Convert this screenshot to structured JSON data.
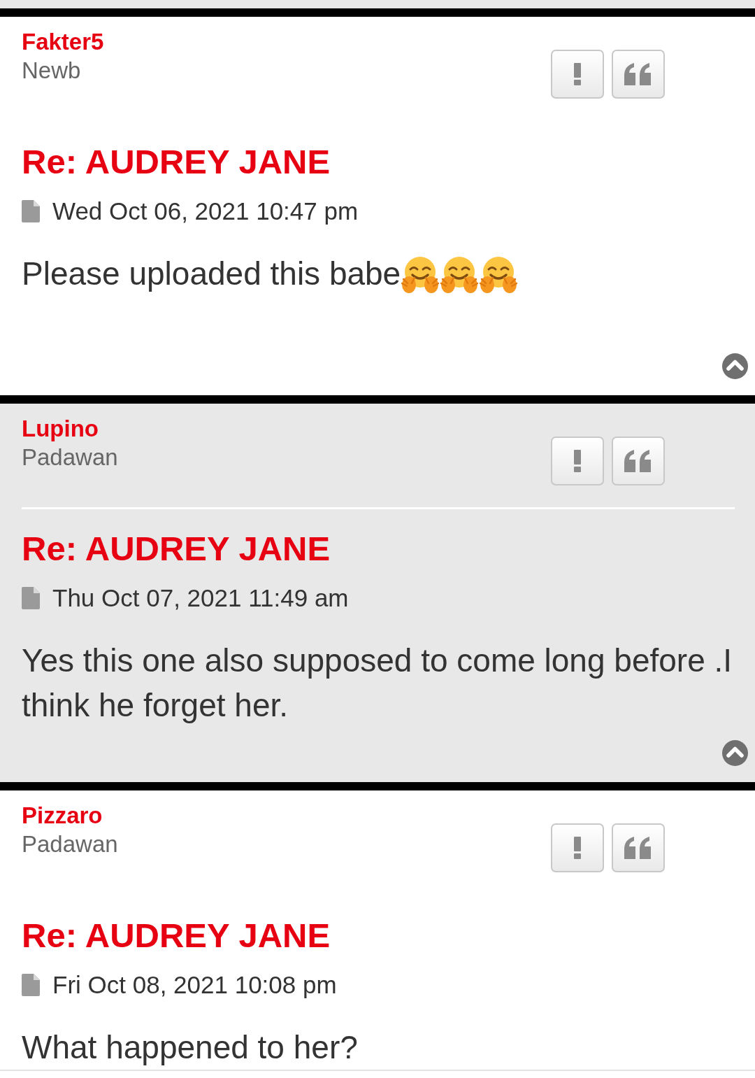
{
  "posts": [
    {
      "username": "Fakter5",
      "rank": "Newb",
      "shaded": false,
      "title": "Re: AUDREY JANE",
      "date": "Wed Oct 06, 2021 10:47 pm",
      "body": "Please uploaded this babe",
      "emoji": [
        {
          "kind": "hugging"
        },
        {
          "kind": "hugging"
        },
        {
          "kind": "hugging"
        }
      ],
      "back_to_top": true
    },
    {
      "username": "Lupino",
      "rank": "Padawan",
      "shaded": true,
      "title": "Re: AUDREY JANE",
      "date": "Thu Oct 07, 2021 11:49 am",
      "body": "Yes this one also supposed to come long before .I think he forget her.",
      "back_to_top": true
    },
    {
      "username": "Pizzaro",
      "rank": "Padawan",
      "shaded": false,
      "title": "Re: AUDREY JANE",
      "date": "Fri Oct 08, 2021 10:08 pm",
      "body": "What happened to her?",
      "back_to_top": false
    }
  ]
}
